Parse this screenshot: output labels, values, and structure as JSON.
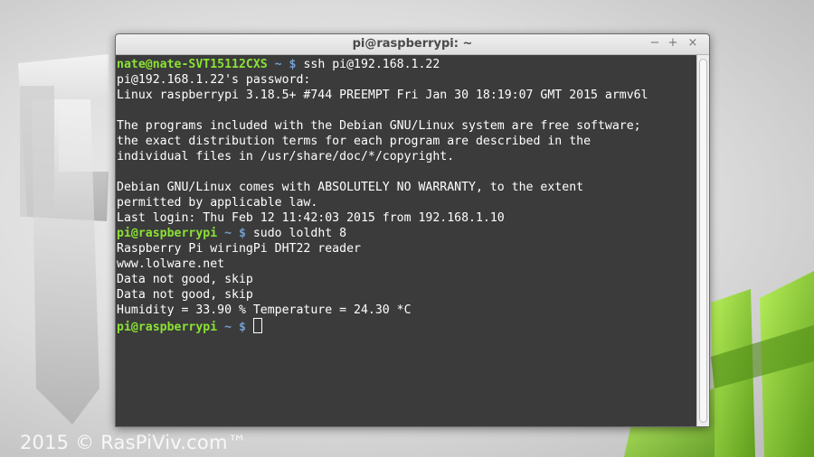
{
  "window": {
    "title": "pi@raspberrypi: ~",
    "minimize": "−",
    "maximize": "+",
    "close": "×"
  },
  "watermark": "2015 © RasPiViv.com™",
  "terminal": {
    "lines": [
      {
        "prompt_user": "nate@nate-SVT15112CXS",
        "prompt_path": " ~ $",
        "text": " ssh pi@192.168.1.22"
      },
      {
        "text": "pi@192.168.1.22's password:"
      },
      {
        "text": "Linux raspberrypi 3.18.5+ #744 PREEMPT Fri Jan 30 18:19:07 GMT 2015 armv6l"
      },
      {
        "text": ""
      },
      {
        "text": "The programs included with the Debian GNU/Linux system are free software;"
      },
      {
        "text": "the exact distribution terms for each program are described in the"
      },
      {
        "text": "individual files in /usr/share/doc/*/copyright."
      },
      {
        "text": ""
      },
      {
        "text": "Debian GNU/Linux comes with ABSOLUTELY NO WARRANTY, to the extent"
      },
      {
        "text": "permitted by applicable law."
      },
      {
        "text": "Last login: Thu Feb 12 11:42:03 2015 from 192.168.1.10"
      },
      {
        "prompt_user": "pi@raspberrypi",
        "prompt_path": " ~ $",
        "text": " sudo loldht 8"
      },
      {
        "text": "Raspberry Pi wiringPi DHT22 reader"
      },
      {
        "text": "www.lolware.net"
      },
      {
        "text": "Data not good, skip"
      },
      {
        "text": "Data not good, skip"
      },
      {
        "text": "Humidity = 33.90 % Temperature = 24.30 *C"
      },
      {
        "prompt_user": "pi@raspberrypi",
        "prompt_path": " ~ $",
        "text": " ",
        "cursor": true
      }
    ]
  },
  "colors": {
    "prompt_user": "#8ae234",
    "prompt_path": "#729fcf",
    "terminal_bg": "#3b3b3b",
    "terminal_fg": "#ffffff"
  }
}
